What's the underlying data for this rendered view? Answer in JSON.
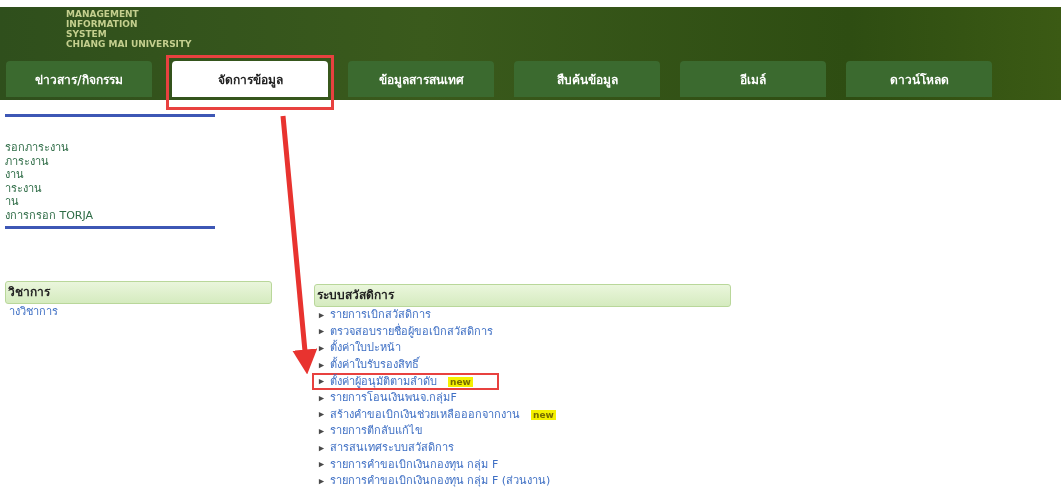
{
  "header": {
    "title_lines": [
      "MANAGEMENT",
      "INFORMATION",
      "SYSTEM",
      "CHIANG MAI UNIVERSITY"
    ]
  },
  "tabs": [
    {
      "label": "ข่าวสาร/กิจกรรม",
      "selected": false,
      "highlighted": false
    },
    {
      "label": "จัดการข้อมูล",
      "selected": true,
      "highlighted": true
    },
    {
      "label": "ข้อมูลสารสนเทศ",
      "selected": false,
      "highlighted": false
    },
    {
      "label": "สืบค้นข้อมูล",
      "selected": false,
      "highlighted": false
    },
    {
      "label": "อีเมล์",
      "selected": false,
      "highlighted": false
    },
    {
      "label": "ดาวน์โหลด",
      "selected": false,
      "highlighted": false
    }
  ],
  "workload_menu": {
    "items": [
      "รอกภาระงาน",
      "ภาระงาน",
      "งาน",
      "าระงาน",
      "าน",
      "งการกรอก TORJA"
    ]
  },
  "sections": [
    {
      "title": "วิชาการ",
      "items": [
        {
          "label": "างวิชาการ",
          "highlighted": false
        }
      ]
    },
    {
      "title": "ระบบสวัสดิการ",
      "items": [
        {
          "label": "รายการเบิกสวัสดิการ",
          "highlighted": false
        },
        {
          "label": "ตรวจสอบรายชื่อผู้ขอเบิกสวัสดิการ",
          "highlighted": false
        },
        {
          "label": "ตั้งค่าใบปะหน้า",
          "highlighted": false
        },
        {
          "label": "ตั้งค่าใบรับรองสิทธิ์",
          "highlighted": false
        },
        {
          "label": "ตั้งค่าผู้อนุมัติตามลำดับ",
          "new_badge": "new",
          "highlighted": true
        },
        {
          "label": "รายการโอนเงินพนจ.กลุ่มF",
          "highlighted": false
        },
        {
          "label": "สร้างคำขอเบิกเงินช่วยเหลือออกจากงาน",
          "new_badge": "new",
          "highlighted": false
        },
        {
          "label": "รายการตีกลับแก้ไข",
          "highlighted": false
        },
        {
          "label": "สารสนเทศระบบสวัสดิการ",
          "highlighted": false
        },
        {
          "label": "รายการคำขอเบิกเงินกองทุน กลุ่ม F",
          "highlighted": false
        },
        {
          "label": "รายการคำขอเบิกเงินกองทุน กลุ่ม F (ส่วนงาน)",
          "highlighted": false
        }
      ]
    }
  ]
}
